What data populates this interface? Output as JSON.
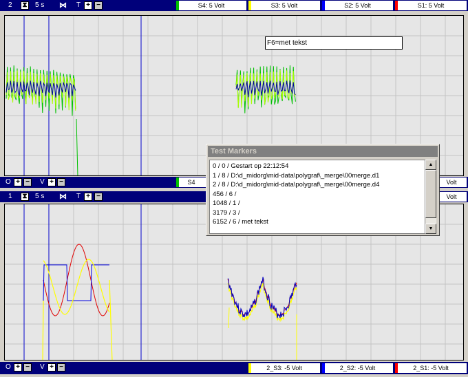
{
  "top_panel": {
    "number": "2",
    "timebase": "5 s",
    "channels": [
      {
        "label": "S4: 5 Volt",
        "color": "#00c000"
      },
      {
        "label": "S3: 5 Volt",
        "color": "#ffff00"
      },
      {
        "label": "S2: 5 Volt",
        "color": "#0000ff"
      },
      {
        "label": "S1: 5 Volt",
        "color": "#ff0000"
      }
    ],
    "marker_note": "F6=met tekst"
  },
  "middle_bar": {
    "o_label": "O",
    "v_label": "V",
    "channel_partial": "S4",
    "channel_right": "Volt",
    "channel_right_color": "#ff0000"
  },
  "bottom_panel": {
    "number": "1",
    "timebase": "5 s",
    "channel_right": "Volt"
  },
  "footer_bar": {
    "o_label": "O",
    "v_label": "V",
    "channels": [
      {
        "label": "2_S3: -5 Volt",
        "color": "#ffff00"
      },
      {
        "label": "2_S2: -5 Volt",
        "color": "#0000ff"
      },
      {
        "label": "2_S1: -5 Volt",
        "color": "#ff0000"
      }
    ]
  },
  "toolbar": {
    "t_label": "T",
    "plus": "+",
    "minus": "−"
  },
  "dialog": {
    "title": "Test Markers",
    "items": [
      "0 / 0 / Gestart op 22:12:54",
      "1 / 8 / D:\\d_midorg\\mid-data\\polygraf\\_merge\\00merge.d1",
      "2 / 8 / D:\\d_midorg\\mid-data\\polygraf\\_merge\\00merge.d4",
      "456 / 6 /",
      "1048 / 1 /",
      "3179 / 3 /",
      "6152 / 6 / met tekst"
    ],
    "scroll_up": "▲",
    "scroll_down": "▼"
  },
  "colors": {
    "bar": "#00007a",
    "plot_bg": "#e6e6e6",
    "grid": "#c4c4c4",
    "marker_line": "#0000cc"
  }
}
